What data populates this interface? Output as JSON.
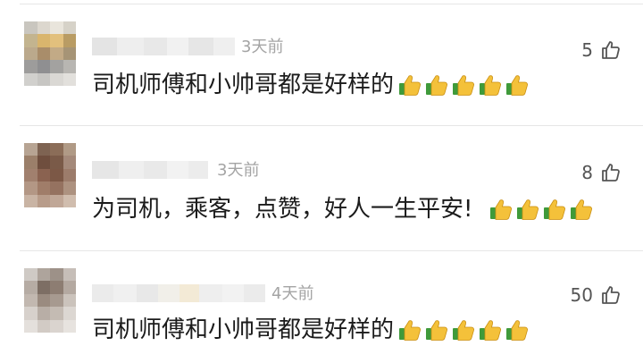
{
  "comments": [
    {
      "time": "3天前",
      "likes": "5",
      "text": "司机师傅和小帅哥都是好样的",
      "emojis": [
        "thumbs-up",
        "thumbs-up",
        "thumbs-up",
        "thumbs-up",
        "thumbs-up"
      ]
    },
    {
      "time": "3天前",
      "likes": "8",
      "text": "为司机，乘客，点赞，好人一生平安!",
      "emojis": [
        "thumbs-up",
        "thumbs-up",
        "thumbs-up",
        "thumbs-up"
      ]
    },
    {
      "time": "4天前",
      "likes": "50",
      "text": "司机师傅和小帅哥都是好样的",
      "emojis": [
        "thumbs-up",
        "thumbs-up",
        "thumbs-up",
        "thumbs-up",
        "thumbs-up"
      ]
    }
  ],
  "icons": {
    "like": "thumbs-up-outline-icon",
    "emoji": "thumbs-up-emoji-icon"
  },
  "colors": {
    "divider": "#e6e6e6",
    "time": "#a4a4a4",
    "emoji_yellow": "#f4c13a",
    "emoji_green": "#3f9a3a"
  }
}
